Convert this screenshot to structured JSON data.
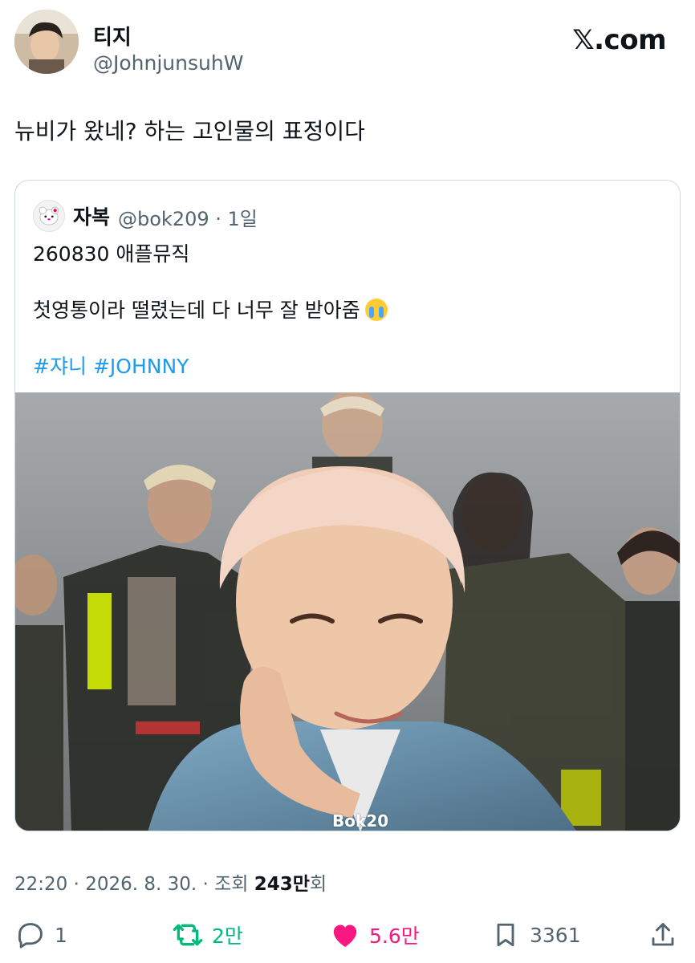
{
  "brand": "𝕏.com",
  "author": {
    "display_name": "티지",
    "handle": "@JohnjunsuhW"
  },
  "tweet": {
    "text": "뉴비가 왔네? 하는 고인물의 표정이다"
  },
  "quoted": {
    "display_name": "자복",
    "handle_time": "@bok209 · 1일",
    "line1": "260830 애플뮤직",
    "line2": "첫영통이라 떨렸는데 다 너무 잘 받아줌",
    "emoji": "loudly-crying-face",
    "hashtags": [
      "#쟈니",
      "#JOHNNY"
    ],
    "photo_watermark": "Bok20"
  },
  "meta": {
    "time_date": "22:20 · 2026. 8. 30. · ",
    "views_label": "조회 ",
    "views_value": "243만",
    "views_suffix": "회"
  },
  "actions": {
    "replies": "1",
    "reposts": "2만",
    "likes": "5.6만",
    "bookmarks": "3361"
  },
  "colors": {
    "text": "#0f1419",
    "secondary": "#536471",
    "link": "#1d9bf0",
    "repost": "#00ba7c",
    "like": "#f91880",
    "border": "#cfd9de"
  }
}
